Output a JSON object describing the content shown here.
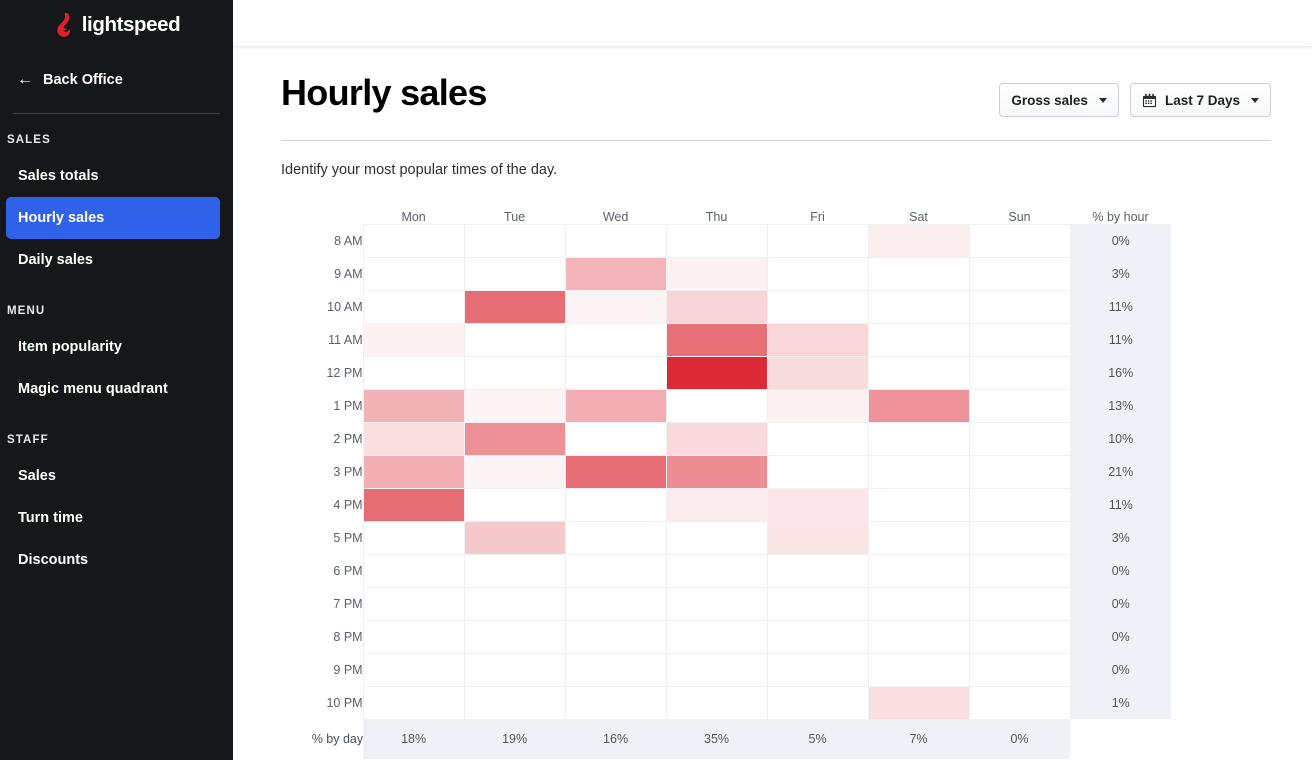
{
  "sidebar": {
    "logo": {
      "icon": "lightspeed-flame-icon",
      "word": "lightspeed",
      "color": "#E02029"
    },
    "back": {
      "icon": "arrow-left-icon",
      "label": "Back Office"
    },
    "sections": [
      {
        "title": "SALES",
        "items": [
          {
            "label": "Sales totals",
            "active": false
          },
          {
            "label": "Hourly sales",
            "active": true
          },
          {
            "label": "Daily sales",
            "active": false
          }
        ]
      },
      {
        "title": "MENU",
        "items": [
          {
            "label": "Item popularity",
            "active": false
          },
          {
            "label": "Magic menu quadrant",
            "active": false
          }
        ]
      },
      {
        "title": "STAFF",
        "items": [
          {
            "label": "Sales",
            "active": false
          },
          {
            "label": "Turn time",
            "active": false
          },
          {
            "label": "Discounts",
            "active": false
          }
        ]
      }
    ],
    "active_color": "#2F62E8",
    "background": "#15171A"
  },
  "header": {
    "title": "Hourly sales",
    "subtitle": "Identify your most popular times of the day.",
    "metric_dropdown": {
      "label": "Gross sales",
      "icon": "chevron-down-icon"
    },
    "date_dropdown": {
      "label": "Last 7 Days",
      "icon": "calendar-icon",
      "chevron": "chevron-down-icon"
    }
  },
  "chart_data": {
    "type": "heatmap",
    "title": "Hourly sales",
    "subtitle": "Identify your most popular times of the day.",
    "xlabel": "",
    "ylabel": "",
    "categories": [
      "Mon",
      "Tue",
      "Wed",
      "Thu",
      "Fri",
      "Sat",
      "Sun"
    ],
    "rows": [
      "8 AM",
      "9 AM",
      "10 AM",
      "11 AM",
      "12 PM",
      "1 PM",
      "2 PM",
      "3 PM",
      "4 PM",
      "5 PM",
      "6 PM",
      "7 PM",
      "8 PM",
      "9 PM",
      "10 PM"
    ],
    "row_total_header": "% by hour",
    "col_total_header": "% by day",
    "row_totals": [
      "0%",
      "3%",
      "11%",
      "11%",
      "16%",
      "13%",
      "10%",
      "21%",
      "11%",
      "3%",
      "0%",
      "0%",
      "0%",
      "0%",
      "1%"
    ],
    "col_totals": [
      "18%",
      "19%",
      "16%",
      "35%",
      "5%",
      "7%",
      "0%"
    ],
    "colorscale": {
      "min": "#FFFFFF",
      "max": "#DC2B36",
      "mid": "#E97F85",
      "light": "#F2B4B9"
    },
    "values": [
      [
        0.0,
        0.0,
        0.0,
        0.0,
        0.0,
        0.04,
        0.0
      ],
      [
        0.0,
        0.0,
        0.26,
        0.03,
        0.0,
        0.0,
        0.0
      ],
      [
        0.0,
        0.62,
        0.02,
        0.13,
        0.0,
        0.0,
        0.0
      ],
      [
        0.03,
        0.0,
        0.0,
        0.6,
        0.12,
        0.0,
        0.0
      ],
      [
        0.0,
        0.0,
        0.0,
        1.0,
        0.1,
        0.0,
        0.0
      ],
      [
        0.27,
        0.02,
        0.29,
        0.0,
        0.03,
        0.42,
        0.0
      ],
      [
        0.09,
        0.43,
        0.0,
        0.11,
        0.0,
        0.0,
        0.0
      ],
      [
        0.29,
        0.02,
        0.62,
        0.45,
        0.0,
        0.0,
        0.0
      ],
      [
        0.62,
        0.0,
        0.0,
        0.05,
        0.06,
        0.0,
        0.0
      ],
      [
        0.0,
        0.17,
        0.0,
        0.0,
        0.07,
        0.0,
        0.0
      ],
      [
        0.0,
        0.0,
        0.0,
        0.0,
        0.0,
        0.0,
        0.0
      ],
      [
        0.0,
        0.0,
        0.0,
        0.0,
        0.0,
        0.0,
        0.0
      ],
      [
        0.0,
        0.0,
        0.0,
        0.0,
        0.0,
        0.0,
        0.0
      ],
      [
        0.0,
        0.0,
        0.0,
        0.0,
        0.0,
        0.0,
        0.0
      ],
      [
        0.0,
        0.0,
        0.0,
        0.0,
        0.0,
        0.09,
        0.0
      ]
    ]
  }
}
